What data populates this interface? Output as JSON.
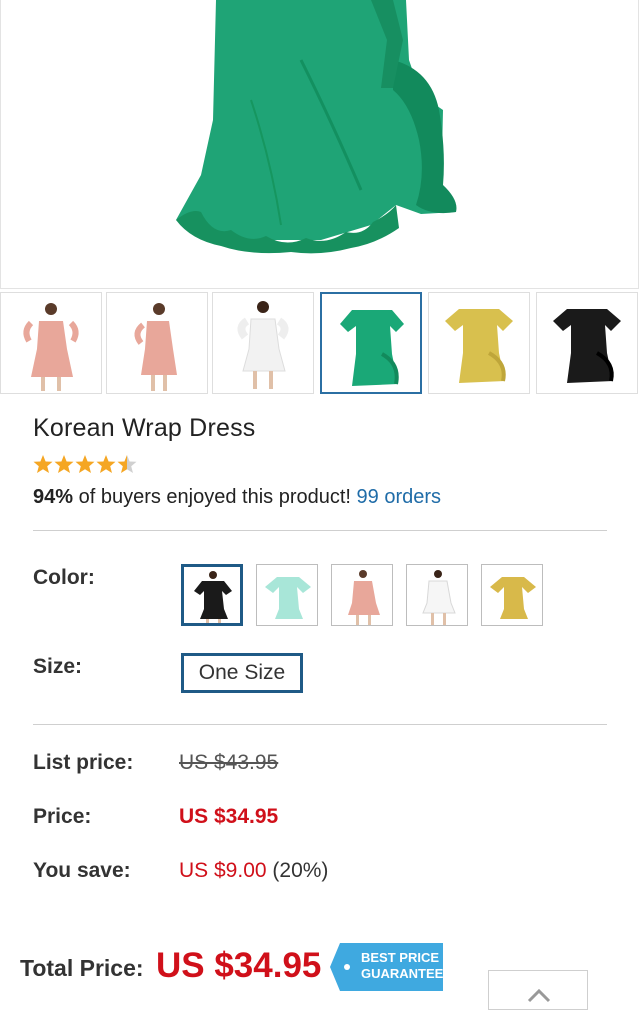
{
  "product": {
    "title": "Korean Wrap Dress",
    "rating": 4.5,
    "enjoy_percent": "94%",
    "enjoy_text": " of buyers enjoyed this product! ",
    "orders": "99 orders"
  },
  "gallery": {
    "thumbnails": [
      {
        "name": "pink dress model front",
        "color": "#e8a79a"
      },
      {
        "name": "pink dress model side",
        "color": "#e8a79a"
      },
      {
        "name": "white dress model",
        "color": "#f4f4f4"
      },
      {
        "name": "green dress flat",
        "color": "#1aa877"
      },
      {
        "name": "yellow dress flat",
        "color": "#d8c04e"
      },
      {
        "name": "black dress flat",
        "color": "#1a1a1a"
      }
    ],
    "active_index": 3
  },
  "options": {
    "color_label": "Color:",
    "colors": [
      {
        "name": "black",
        "color": "#1a1a1a"
      },
      {
        "name": "mint",
        "color": "#a8e6d8"
      },
      {
        "name": "pink",
        "color": "#e8a79a"
      },
      {
        "name": "white",
        "color": "#f6f6f6"
      },
      {
        "name": "yellow",
        "color": "#d8b94a"
      }
    ],
    "selected_color_index": 0,
    "size_label": "Size:",
    "size_value": "One Size"
  },
  "pricing": {
    "list_label": "List price:",
    "list_value": "US $43.95",
    "price_label": "Price:",
    "price_value": "US $34.95",
    "save_label": "You save:",
    "save_value": "US $9.00",
    "save_percent": " (20%)"
  },
  "footer": {
    "total_label": "Total Price:",
    "total_value": "US $34.95",
    "badge_line1": "BEST PRICE",
    "badge_line2": "GUARANTEE"
  },
  "colors": {
    "accent_blue": "#1f5a86",
    "link_blue": "#1f6ca8",
    "price_red": "#d0101a",
    "star_orange": "#f5a623",
    "badge_blue": "#3fa9e0"
  }
}
